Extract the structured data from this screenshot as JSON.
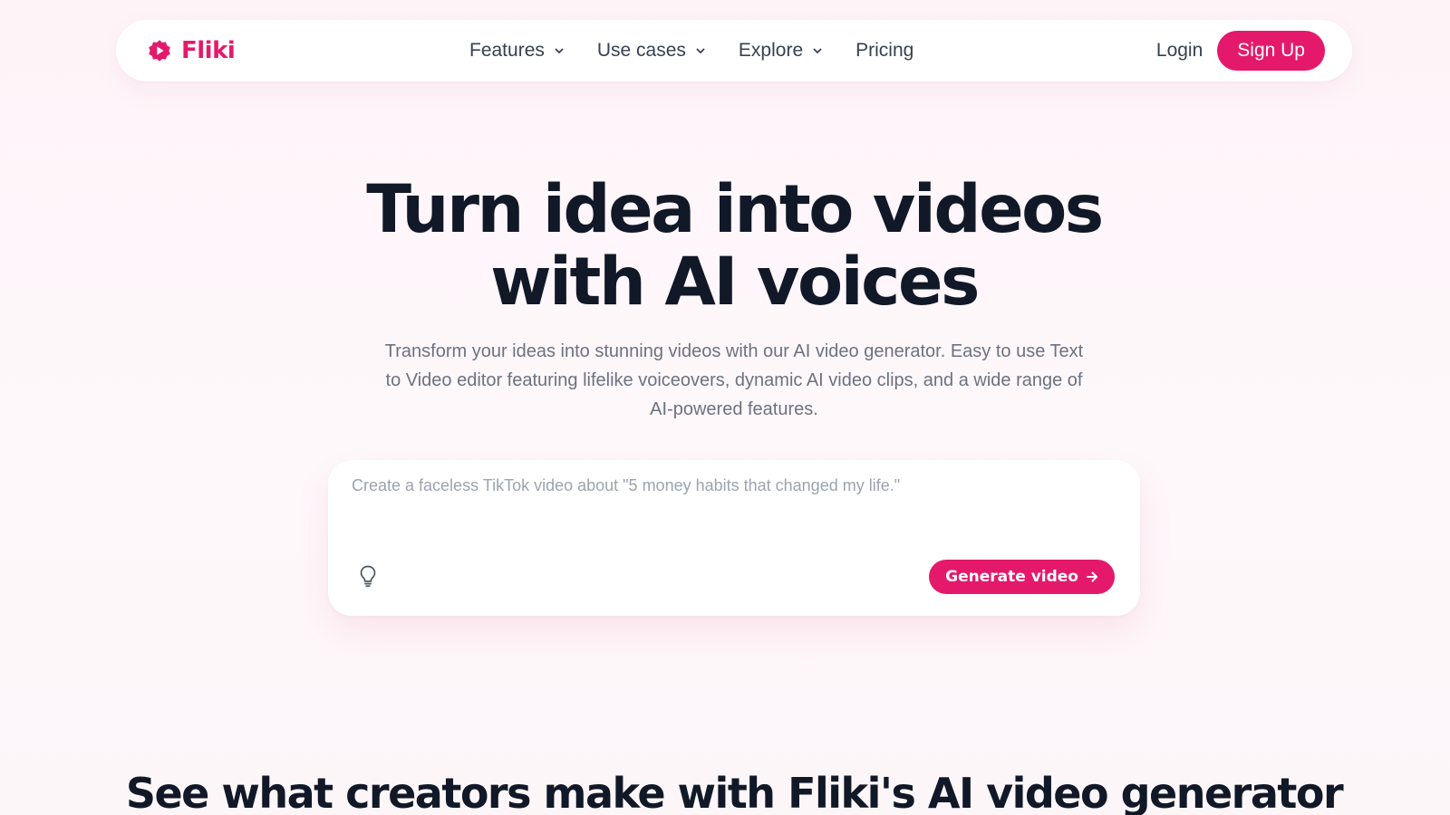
{
  "brand": {
    "name": "Fliki",
    "color": "#e5196b",
    "icon": "fliki-logo-icon"
  },
  "nav": {
    "items": [
      {
        "label": "Features",
        "dropdown": true
      },
      {
        "label": "Use cases",
        "dropdown": true
      },
      {
        "label": "Explore",
        "dropdown": true
      },
      {
        "label": "Pricing",
        "dropdown": false
      }
    ],
    "login": "Login",
    "signup": "Sign Up"
  },
  "hero": {
    "title_line1": "Turn idea into videos",
    "title_line2": "with AI voices",
    "subtitle": "Transform your ideas into stunning videos with our AI video generator. Easy to use Text to Video editor featuring lifelike voiceovers, dynamic AI video clips, and a wide range of AI-powered features."
  },
  "prompt": {
    "placeholder": "Create a faceless TikTok video about \"5 money habits that changed my life.\"",
    "value": "",
    "idea_icon": "lightbulb-icon",
    "generate_label": "Generate video",
    "generate_icon": "arrow-right-icon"
  },
  "section": {
    "title": "See what creators make with Fliki's AI video generator"
  },
  "colors": {
    "accent": "#e5196b",
    "text_dark": "#111827",
    "text_muted": "#6b7280",
    "background": "#fdf6f9"
  }
}
